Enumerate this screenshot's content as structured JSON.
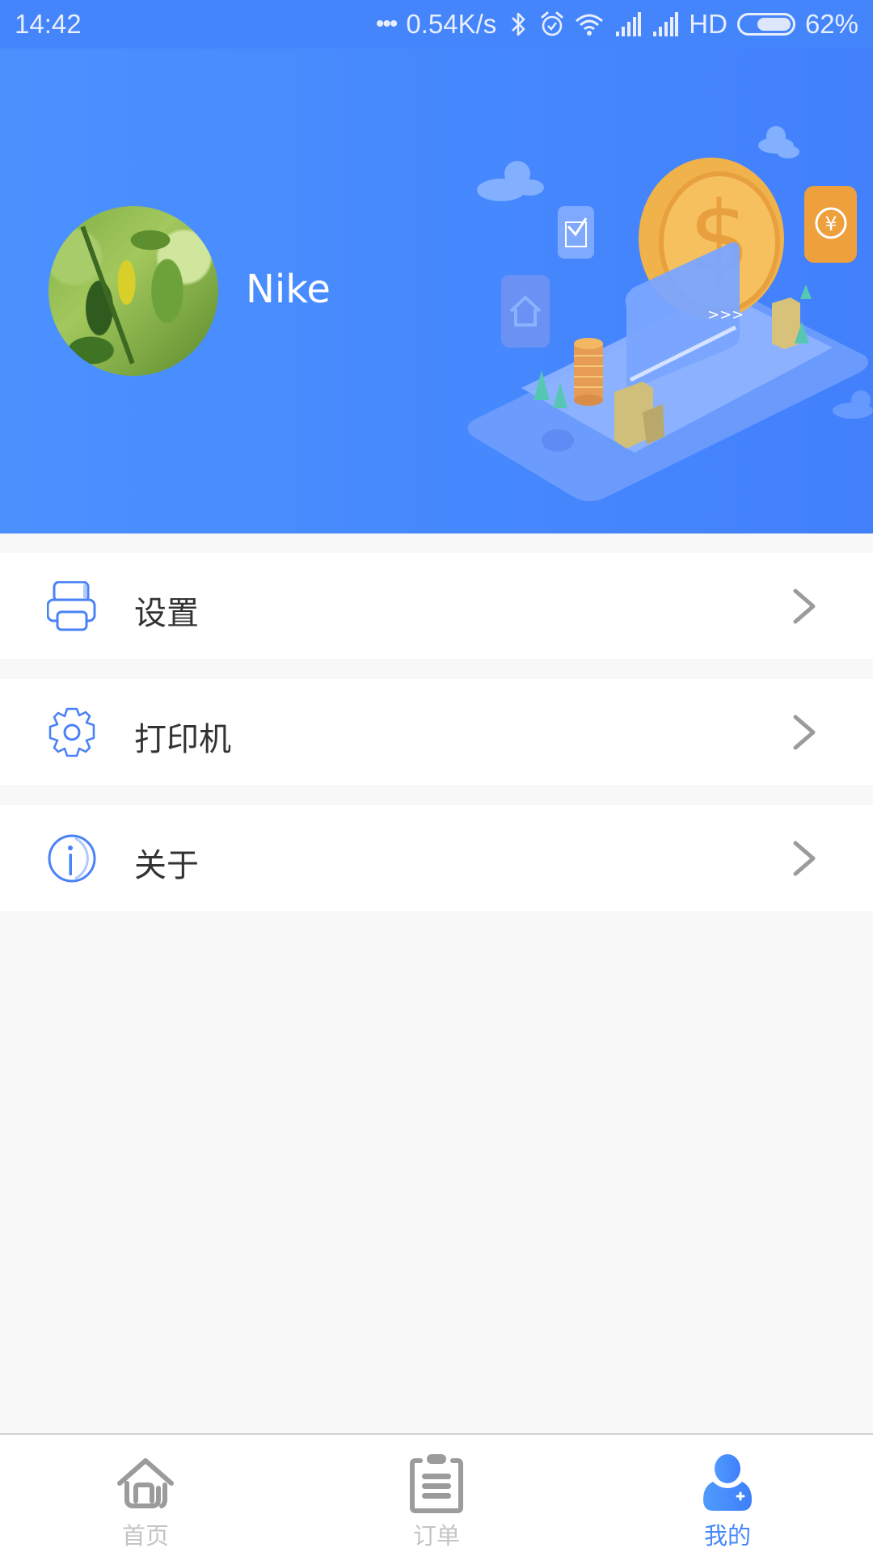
{
  "status_bar": {
    "time": "14:42",
    "dots": "•••",
    "net_speed": "0.54K/s",
    "network_type": "HD",
    "battery_percent": "62%",
    "battery_level": 0.62,
    "icons": [
      "bluetooth-icon",
      "alarm-icon",
      "wifi-icon",
      "signal-icon",
      "signal-icon",
      "battery-icon"
    ]
  },
  "profile": {
    "username": "Nike",
    "avatar": "avatar-photo-leaves",
    "header_color": "#4688fd"
  },
  "menu": {
    "items": [
      {
        "label": "设置",
        "icon": "printer-icon"
      },
      {
        "label": "打印机",
        "icon": "gear-icon"
      },
      {
        "label": "关于",
        "icon": "info-icon"
      }
    ]
  },
  "tabbar": {
    "active_color": "#4587fb",
    "inactive_color": "#9b9b9b",
    "tabs": [
      {
        "label": "首页",
        "icon": "home-icon",
        "active": false
      },
      {
        "label": "订单",
        "icon": "clipboard-icon",
        "active": false
      },
      {
        "label": "我的",
        "icon": "user-icon",
        "active": true
      }
    ]
  }
}
